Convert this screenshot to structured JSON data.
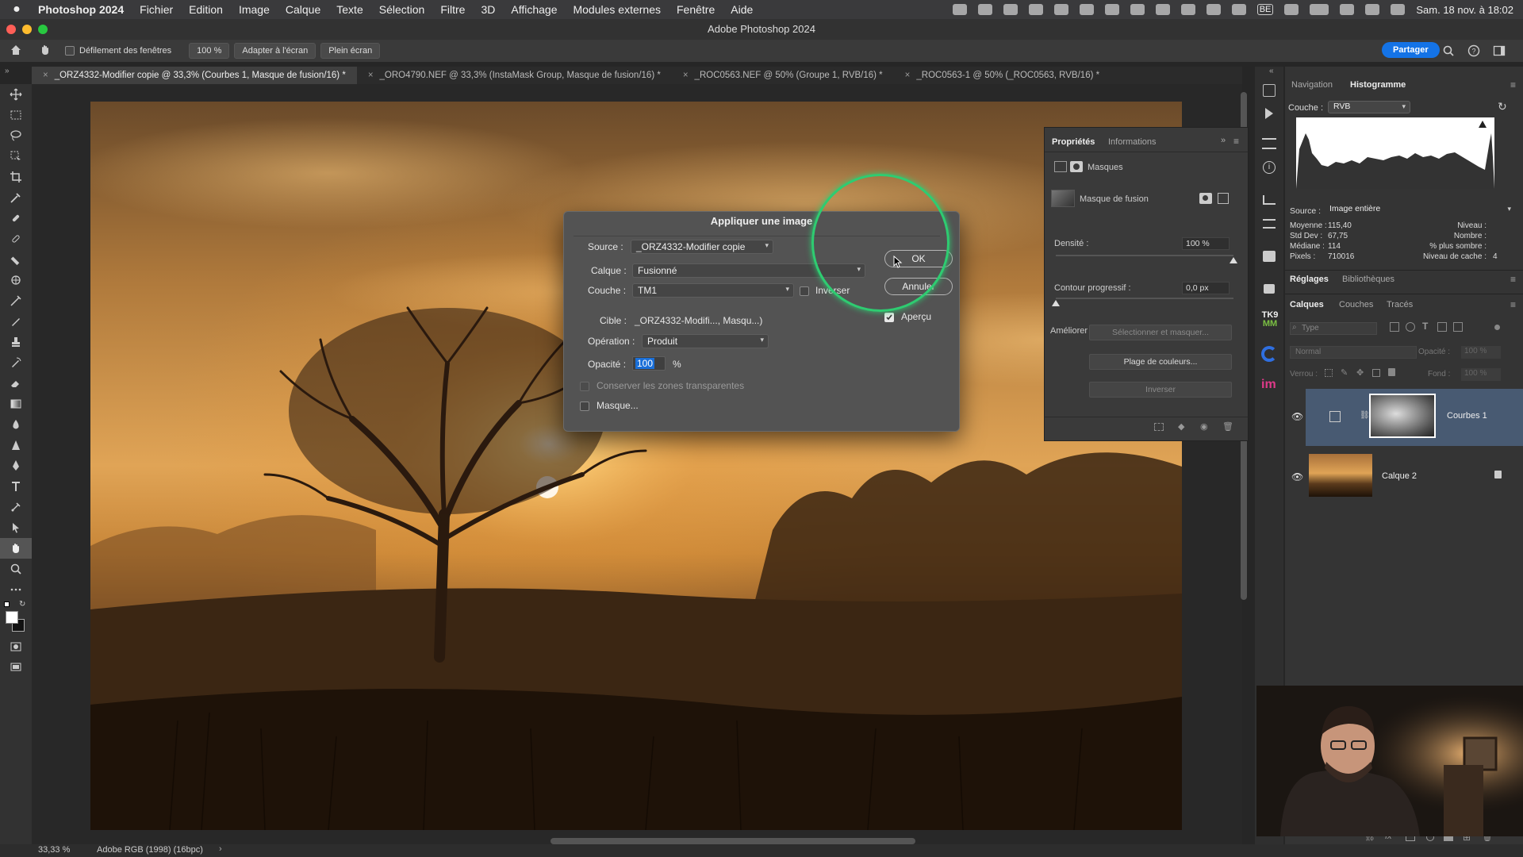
{
  "menubar": {
    "app_name": "Photoshop 2024",
    "items": [
      "Fichier",
      "Edition",
      "Image",
      "Calque",
      "Texte",
      "Sélection",
      "Filtre",
      "3D",
      "Affichage",
      "Modules externes",
      "Fenêtre",
      "Aide"
    ],
    "keyboard_badge": "BE",
    "clock": "Sam. 18 nov. à 18:02"
  },
  "window": {
    "title": "Adobe Photoshop 2024"
  },
  "options": {
    "scroll_all_label": "Défilement des fenêtres",
    "zoom_value": "100 %",
    "fit_screen_label": "Adapter à l'écran",
    "full_screen_label": "Plein écran",
    "share_label": "Partager"
  },
  "tabs": [
    "_ORZ4332-Modifier copie @ 33,3% (Courbes 1, Masque de fusion/16) *",
    "_ORO4790.NEF @ 33,3% (InstaMask Group, Masque de fusion/16) *",
    "_ROC0563.NEF @ 50% (Groupe 1, RVB/16) *",
    "_ROC0563-1 @ 50% (_ROC0563, RVB/16) *"
  ],
  "dialog": {
    "title": "Appliquer une image",
    "source_label": "Source :",
    "source_value": "_ORZ4332-Modifier copie",
    "layer_label": "Calque :",
    "layer_value": "Fusionné",
    "channel_label": "Couche :",
    "channel_value": "TM1",
    "invert_label": "Inverser",
    "target_label": "Cible :",
    "target_value": "_ORZ4332-Modifi..., Masqu...)",
    "blending_label": "Opération :",
    "blending_value": "Produit",
    "opacity_label": "Opacité :",
    "opacity_value": "100",
    "opacity_unit": "%",
    "preserve_label": "Conserver les zones transparentes",
    "mask_label": "Masque...",
    "ok_label": "OK",
    "cancel_label": "Annuler",
    "preview_label": "Aperçu",
    "preview_checked": true,
    "invert_checked": false,
    "mask_checked": false
  },
  "properties": {
    "tab_properties": "Propriétés",
    "tab_info": "Informations",
    "masks_label": "Masques",
    "mask_name": "Masque de fusion",
    "density_label": "Densité :",
    "density_value": "100 %",
    "density_fraction": 1.0,
    "feather_label": "Contour progressif :",
    "feather_value": "0,0 px",
    "feather_fraction": 0.0,
    "refine_label": "Améliorer",
    "select_mask_label": "Sélectionner et masquer...",
    "color_range_label": "Plage de couleurs...",
    "invert_label": "Inverser"
  },
  "histogram": {
    "tab_navigation": "Navigation",
    "tab_histogram": "Histogramme",
    "channel_label": "Couche :",
    "channel_value": "RVB",
    "source_label": "Source :",
    "source_value": "Image entière",
    "stats": {
      "mean_label": "Moyenne :",
      "mean": "115,40",
      "stddev_label": "Std Dev :",
      "stddev": "67,75",
      "median_label": "Médiane :",
      "median": "114",
      "pixels_label": "Pixels :",
      "pixels": "710016",
      "level_label": "Niveau :",
      "count_label": "Nombre :",
      "percentile_label": "% plus sombre :",
      "cache_label": "Niveau de cache :",
      "cache": "4"
    }
  },
  "adjustments": {
    "tab_adjust": "Réglages",
    "tab_libraries": "Bibliothèques"
  },
  "layers": {
    "tab_layers": "Calques",
    "tab_channels": "Couches",
    "tab_paths": "Tracés",
    "search_placeholder": "Type",
    "blend_mode": "Normal",
    "opacity_label": "Opacité :",
    "opacity_value": "100 %",
    "lock_label": "Verrou :",
    "fill_label": "Fond :",
    "fill_value": "100 %",
    "items": [
      {
        "name": "Courbes 1",
        "selected": true
      },
      {
        "name": "Calque 2",
        "selected": false
      }
    ]
  },
  "status": {
    "zoom": "33,33 %",
    "profile": "Adobe RGB (1998) (16bpc)"
  },
  "plugins": {
    "tk_label": "TK9",
    "mm_label": "MM",
    "im_label": "im"
  },
  "colors": {
    "accent": "#1473e6",
    "highlight_ring": "#2ecc71"
  }
}
